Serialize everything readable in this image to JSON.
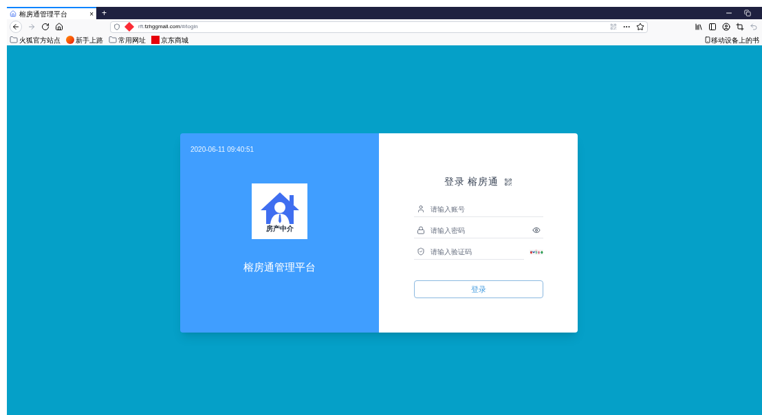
{
  "browser": {
    "tab": {
      "title": "榕房通管理平台",
      "close": "×",
      "selected": true
    },
    "new_tab": "+",
    "address": {
      "host": "rft.",
      "domain": "fzhggmall.com",
      "path": "/#/login"
    },
    "bookmarks": [
      {
        "kind": "folder",
        "label": "火狐官方站点"
      },
      {
        "kind": "firefox",
        "label": "新手上路"
      },
      {
        "kind": "folder",
        "label": "常用网址"
      },
      {
        "kind": "jd",
        "label": "京东商城"
      }
    ],
    "mobile_bookmarks": "移动设备上的书"
  },
  "login": {
    "timestamp": "2020-06-11 09:40:51",
    "logo_caption": "房产中介",
    "platform_name": "榕房通管理平台",
    "heading": "登录 榕房通",
    "fields": [
      {
        "kind": "user",
        "placeholder": "请输入账号"
      },
      {
        "kind": "password",
        "placeholder": "请输入密码"
      },
      {
        "kind": "captcha",
        "placeholder": "请输入验证码"
      }
    ],
    "submit": "登录"
  }
}
